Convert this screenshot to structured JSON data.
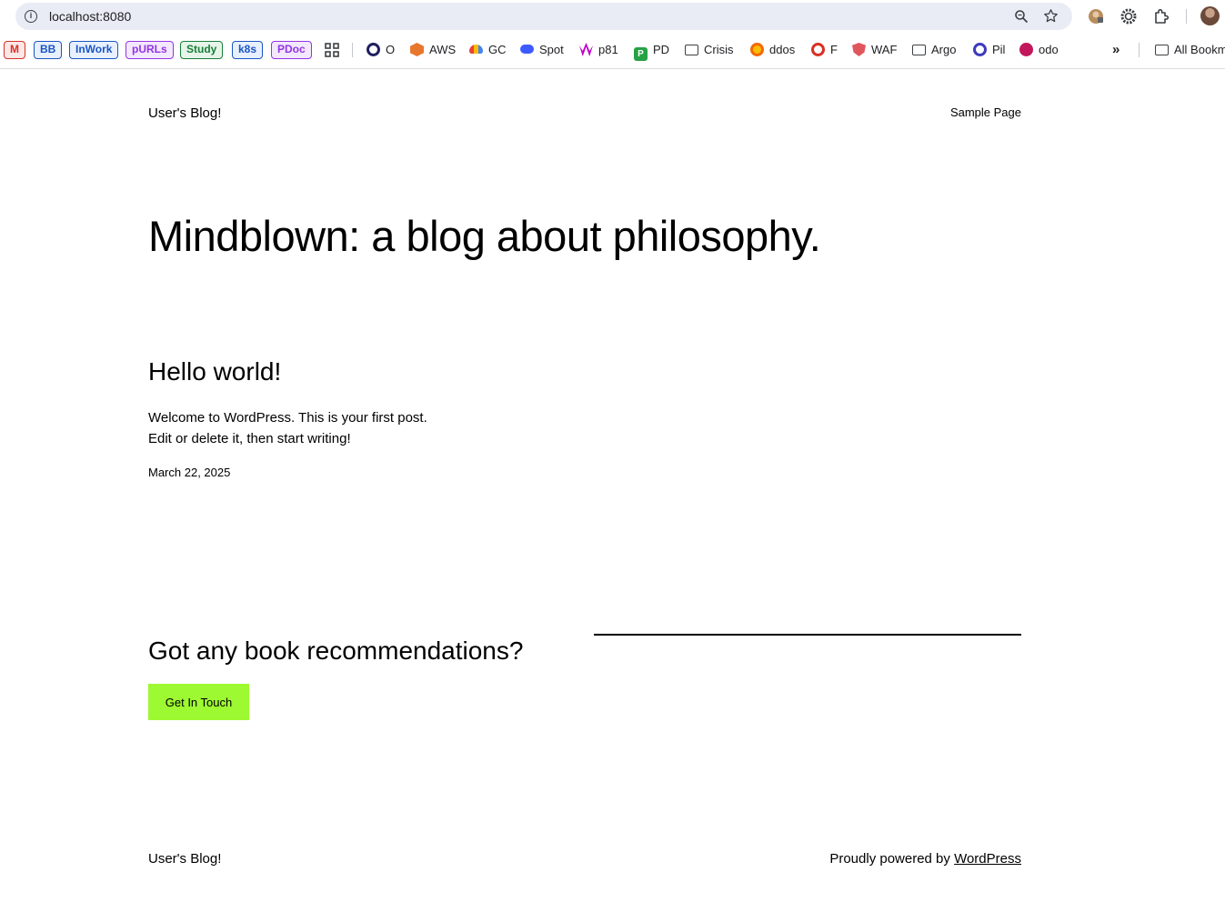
{
  "browser": {
    "url": "localhost:8080",
    "bookmarks_chips": [
      {
        "label": "M",
        "color": "#d93025",
        "bg": "#fce8e6"
      },
      {
        "label": "BB",
        "color": "#1a56c4",
        "bg": "#e8f0fe"
      },
      {
        "label": "InWork",
        "color": "#1a56c4",
        "bg": "#e8f0fe"
      },
      {
        "label": "pURLs",
        "color": "#9334e6",
        "bg": "#f3e8fd"
      },
      {
        "label": "Study",
        "color": "#188038",
        "bg": "#e6f4ea"
      },
      {
        "label": "k8s",
        "color": "#1a56c4",
        "bg": "#e8f0fe"
      },
      {
        "label": "PDoc",
        "color": "#9334e6",
        "bg": "#f3e8fd"
      }
    ],
    "bookmarks": [
      {
        "label": "O",
        "icon": "circle-o-icon"
      },
      {
        "label": "AWS",
        "icon": "aws-icon"
      },
      {
        "label": "GC",
        "icon": "google-cloud-icon"
      },
      {
        "label": "Spot",
        "icon": "spot-icon"
      },
      {
        "label": "p81",
        "icon": "p81-icon"
      },
      {
        "label": "PD",
        "icon": "pd-icon"
      },
      {
        "label": "Crisis",
        "icon": "folder-icon"
      },
      {
        "label": "ddos",
        "icon": "grafana-icon"
      },
      {
        "label": "F",
        "icon": "f-icon"
      },
      {
        "label": "WAF",
        "icon": "shield-icon"
      },
      {
        "label": "Argo",
        "icon": "folder-icon"
      },
      {
        "label": "Pil",
        "icon": "pil-icon"
      },
      {
        "label": "odo",
        "icon": "odo-icon"
      }
    ],
    "all_bookmarks": "All Bookm"
  },
  "site": {
    "title": "User's Blog!",
    "nav_link": "Sample Page"
  },
  "hero": {
    "heading": "Mindblown: a blog about philosophy."
  },
  "post": {
    "title": "Hello world!",
    "body_line1": "Welcome to WordPress. This is your first post.",
    "body_line2": "Edit or delete it, then start writing!",
    "date": "March 22, 2025"
  },
  "cta": {
    "heading": "Got any book recommendations?",
    "button_label": "Get In Touch",
    "button_color": "#9df931"
  },
  "footer": {
    "title": "User's Blog!",
    "credit_prefix": "Proudly powered by ",
    "credit_link": "WordPress"
  }
}
